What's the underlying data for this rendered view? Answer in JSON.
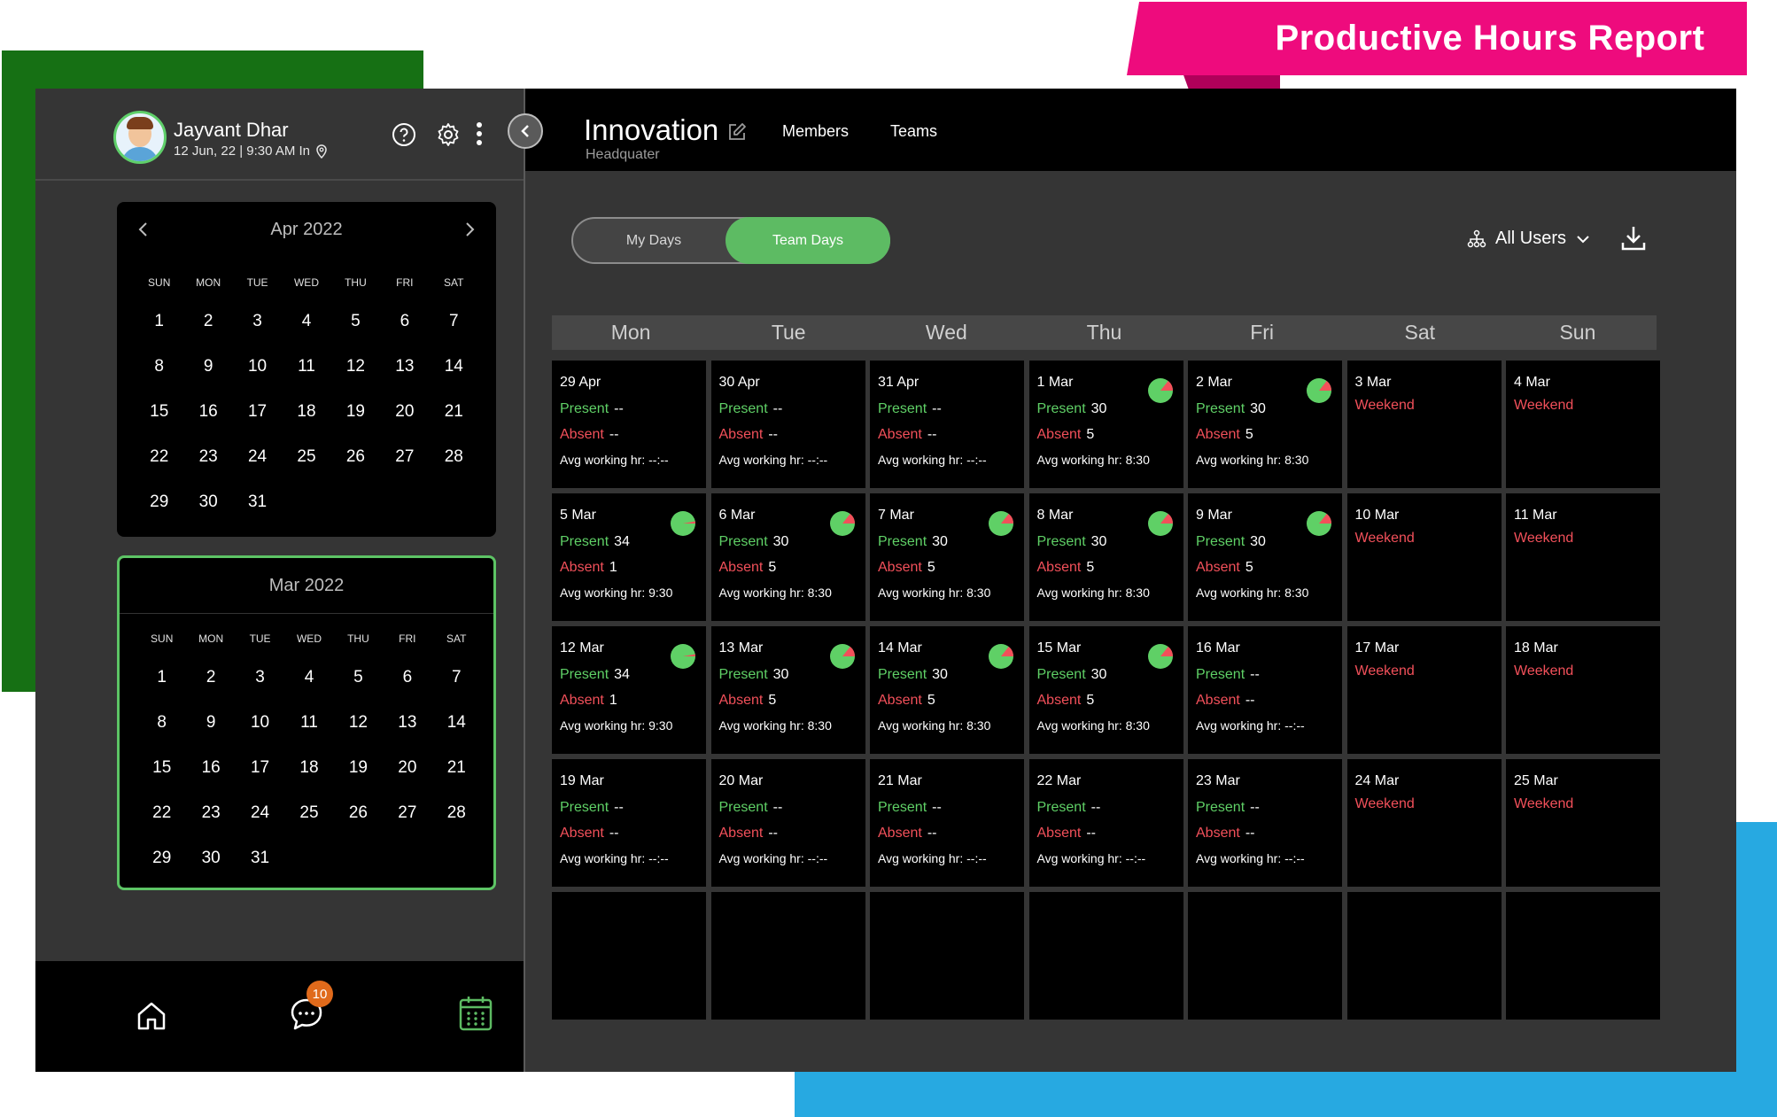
{
  "banner": {
    "title": "Productive Hours Report"
  },
  "profile": {
    "name": "Jayvant Dhar",
    "meta": "12 Jun, 22 | 9:30 AM In"
  },
  "calendars": {
    "dow": [
      "SUN",
      "MON",
      "TUE",
      "WED",
      "THU",
      "FRI",
      "SAT"
    ],
    "apr": {
      "title": "Apr 2022",
      "days": [
        "1",
        "2",
        "3",
        "4",
        "5",
        "6",
        "7",
        "8",
        "9",
        "10",
        "11",
        "12",
        "13",
        "14",
        "15",
        "16",
        "17",
        "18",
        "19",
        "20",
        "21",
        "22",
        "23",
        "24",
        "25",
        "26",
        "27",
        "28",
        "29",
        "30",
        "31"
      ]
    },
    "mar": {
      "title": "Mar 2022",
      "days": [
        "1",
        "2",
        "3",
        "4",
        "5",
        "6",
        "7",
        "8",
        "9",
        "10",
        "11",
        "12",
        "13",
        "14",
        "15",
        "16",
        "17",
        "18",
        "19",
        "20",
        "21",
        "22",
        "23",
        "24",
        "25",
        "26",
        "27",
        "28",
        "29",
        "30",
        "31"
      ]
    }
  },
  "bottom_nav": {
    "chat_badge": "10"
  },
  "topbar": {
    "title": "Innovation",
    "subtitle": "Headquater",
    "tab_members": "Members",
    "tab_teams": "Teams"
  },
  "toggle": {
    "my_days": "My Days",
    "team_days": "Team Days",
    "active": "Team Days"
  },
  "filter": {
    "label": "All Users"
  },
  "weekdays": [
    "Mon",
    "Tue",
    "Wed",
    "Thu",
    "Fri",
    "Sat",
    "Sun"
  ],
  "labels": {
    "present": "Present",
    "absent": "Absent",
    "avg_prefix": "Avg working hr: ",
    "weekend": "Weekend"
  },
  "colors": {
    "present": "#5fd066",
    "absent": "#f2505a",
    "accent": "#5dbb63",
    "banner": "#ee0b7d"
  },
  "cells": [
    {
      "date": "29 Apr",
      "present": "--",
      "absent": "--",
      "avg": "--:--"
    },
    {
      "date": "30 Apr",
      "present": "--",
      "absent": "--",
      "avg": "--:--"
    },
    {
      "date": "31 Apr",
      "present": "--",
      "absent": "--",
      "avg": "--:--"
    },
    {
      "date": "1 Mar",
      "present": "30",
      "absent": "5",
      "avg": "8:30",
      "pie": true
    },
    {
      "date": "2 Mar",
      "present": "30",
      "absent": "5",
      "avg": "8:30",
      "pie": true
    },
    {
      "date": "3 Mar",
      "weekend": true
    },
    {
      "date": "4 Mar",
      "weekend": true
    },
    {
      "date": "5 Mar",
      "present": "34",
      "absent": "1",
      "avg": "9:30",
      "pie": true
    },
    {
      "date": "6 Mar",
      "present": "30",
      "absent": "5",
      "avg": "8:30",
      "pie": true
    },
    {
      "date": "7 Mar",
      "present": "30",
      "absent": "5",
      "avg": "8:30",
      "pie": true
    },
    {
      "date": "8 Mar",
      "present": "30",
      "absent": "5",
      "avg": "8:30",
      "pie": true
    },
    {
      "date": "9 Mar",
      "present": "30",
      "absent": "5",
      "avg": "8:30",
      "pie": true
    },
    {
      "date": "10 Mar",
      "weekend": true
    },
    {
      "date": "11 Mar",
      "weekend": true
    },
    {
      "date": "12 Mar",
      "present": "34",
      "absent": "1",
      "avg": "9:30",
      "pie": true
    },
    {
      "date": "13 Mar",
      "present": "30",
      "absent": "5",
      "avg": "8:30",
      "pie": true
    },
    {
      "date": "14 Mar",
      "present": "30",
      "absent": "5",
      "avg": "8:30",
      "pie": true
    },
    {
      "date": "15 Mar",
      "present": "30",
      "absent": "5",
      "avg": "8:30",
      "pie": true
    },
    {
      "date": "16 Mar",
      "present": "--",
      "absent": "--",
      "avg": "--:--"
    },
    {
      "date": "17 Mar",
      "weekend": true
    },
    {
      "date": "18 Mar",
      "weekend": true
    },
    {
      "date": "19 Mar",
      "present": "--",
      "absent": "--",
      "avg": "--:--"
    },
    {
      "date": "20 Mar",
      "present": "--",
      "absent": "--",
      "avg": "--:--"
    },
    {
      "date": "21 Mar",
      "present": "--",
      "absent": "--",
      "avg": "--:--"
    },
    {
      "date": "22 Mar",
      "present": "--",
      "absent": "--",
      "avg": "--:--"
    },
    {
      "date": "23 Mar",
      "present": "--",
      "absent": "--",
      "avg": "--:--"
    },
    {
      "date": "24 Mar",
      "weekend": true
    },
    {
      "date": "25 Mar",
      "weekend": true
    },
    {
      "empty": true
    },
    {
      "empty": true
    },
    {
      "empty": true
    },
    {
      "empty": true
    },
    {
      "empty": true
    },
    {
      "empty": true
    },
    {
      "empty": true
    }
  ]
}
